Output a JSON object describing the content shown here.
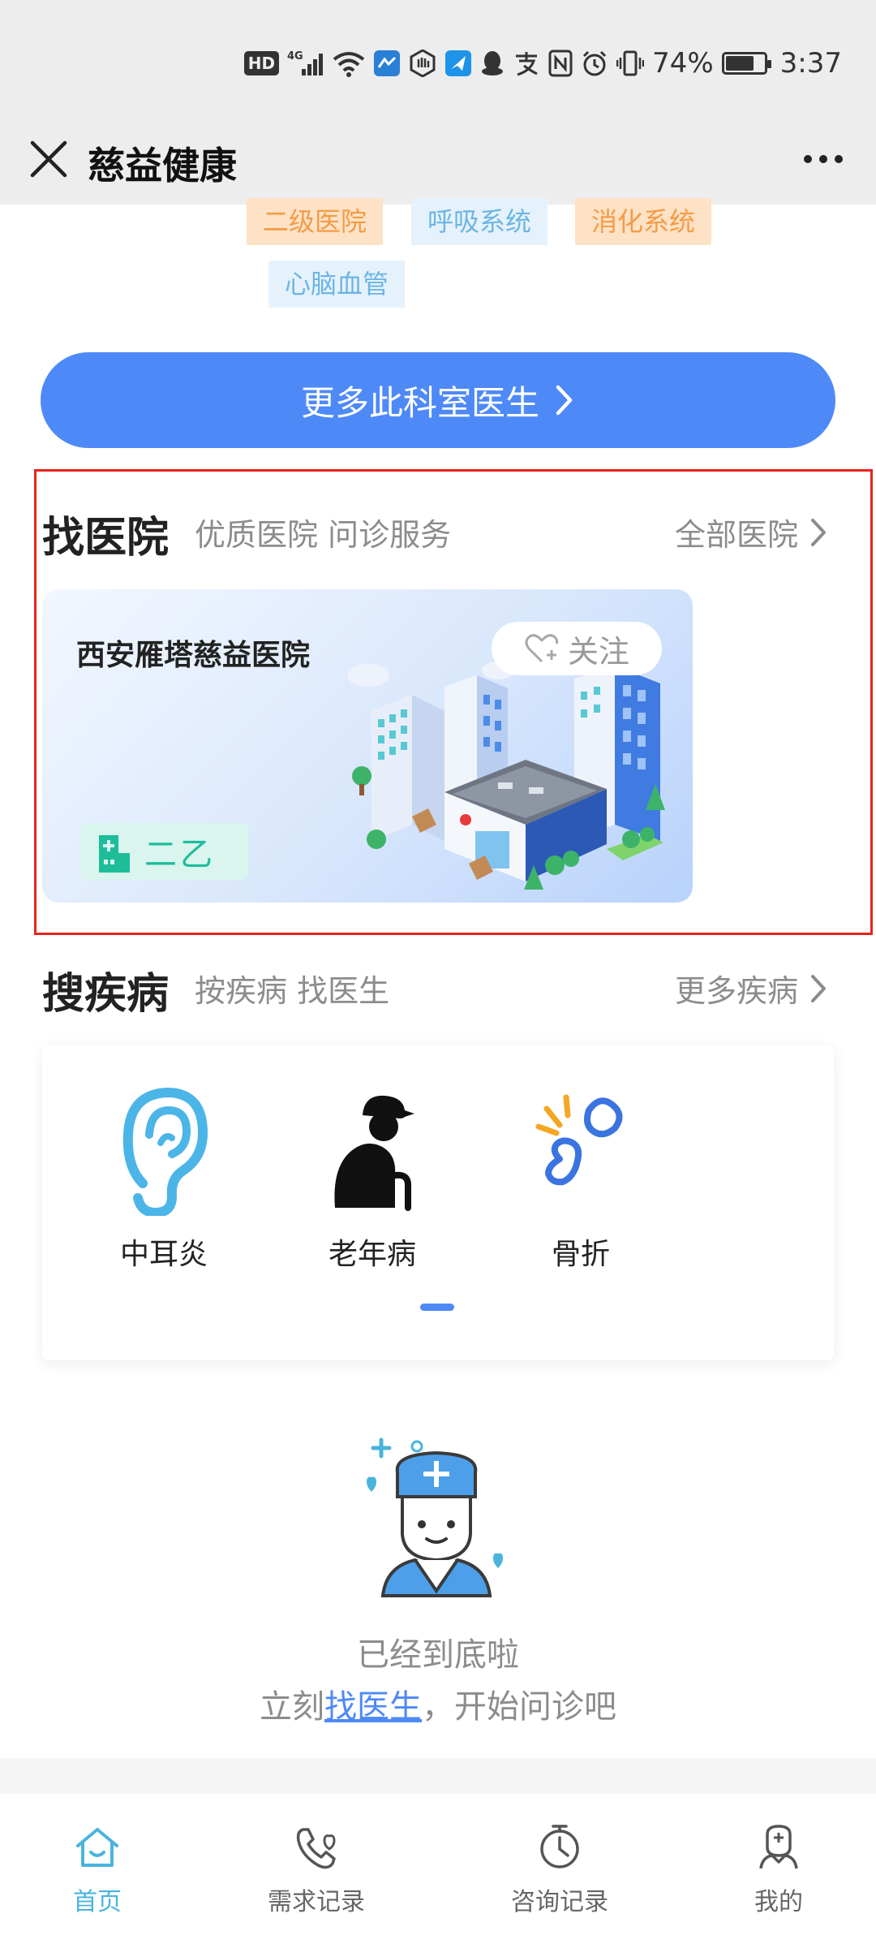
{
  "status_bar": {
    "hd": "HD",
    "network": "4G",
    "battery_percent": "74%",
    "battery_level": 0.74,
    "time": "3:37"
  },
  "title_bar": {
    "title": "慈益健康",
    "icons": [
      "close-icon",
      "more-icon"
    ]
  },
  "tags": [
    {
      "label": "二级医院",
      "color": "orange"
    },
    {
      "label": "呼吸系统",
      "color": "blue"
    },
    {
      "label": "消化系统",
      "color": "orange"
    },
    {
      "label": "心脑血管",
      "color": "blue"
    }
  ],
  "more_doctors_button": {
    "label": "更多此科室医生"
  },
  "hospital_section": {
    "title": "找医院",
    "subtitle": "优质医院 问诊服务",
    "link": "全部医院",
    "card": {
      "name": "西安雁塔慈益医院",
      "follow_label": "关注",
      "grade": "二乙"
    }
  },
  "disease_section": {
    "title": "搜疾病",
    "subtitle": "按疾病 找医生",
    "link": "更多疾病",
    "items": [
      {
        "label": "中耳炎",
        "icon": "ear-icon"
      },
      {
        "label": "老年病",
        "icon": "elderly-icon"
      },
      {
        "label": "骨折",
        "icon": "fracture-icon"
      }
    ]
  },
  "end_message": {
    "line1": "已经到底啦",
    "line2_prefix": "立刻",
    "line2_link": "找医生",
    "line2_suffix": "，开始问诊吧"
  },
  "tab_bar": {
    "items": [
      {
        "label": "首页",
        "icon": "home-icon",
        "active": true
      },
      {
        "label": "需求记录",
        "icon": "phone-heart-icon",
        "active": false
      },
      {
        "label": "咨询记录",
        "icon": "clock-icon",
        "active": false
      },
      {
        "label": "我的",
        "icon": "profile-icon",
        "active": false
      }
    ]
  },
  "colors": {
    "primary": "#4e89f8",
    "tab_active": "#49b4de",
    "tag_orange_bg": "#fde2c6",
    "tag_orange_text": "#f59b45",
    "tag_blue_bg": "#e6f2fb",
    "tag_blue_text": "#6cb5e4",
    "grade_green": "#1dbd9a"
  }
}
